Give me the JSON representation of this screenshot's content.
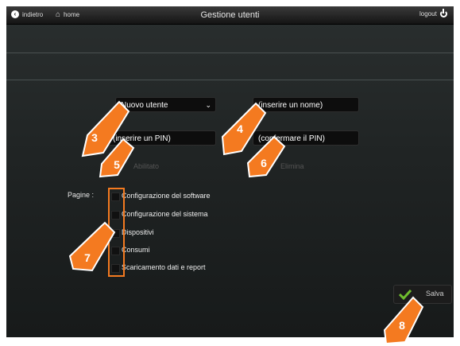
{
  "header": {
    "back_label": "indietro",
    "home_label": "home",
    "title": "Gestione utenti",
    "logout_label": "logout"
  },
  "form": {
    "user_select_value": "Nuovo utente",
    "name_placeholder": "(inserire un nome)",
    "pin_placeholder": "(inserire un PIN)",
    "pin_confirm_placeholder": "(confermare il PIN)",
    "enabled_label": "Abilitato",
    "admin_label": "Elimina"
  },
  "pages": {
    "label": "Pagine :",
    "items": [
      {
        "label": "Configurazione del software",
        "checked": false
      },
      {
        "label": "Configurazione del sistema",
        "checked": false
      },
      {
        "label": "Dispositivi",
        "checked": false
      },
      {
        "label": "Consumi",
        "checked": false
      },
      {
        "label": "Scaricamento dati e report",
        "checked": false
      }
    ]
  },
  "actions": {
    "save_label": "Salva"
  },
  "callouts": [
    "3",
    "4",
    "5",
    "6",
    "7",
    "8"
  ],
  "colors": {
    "accent": "#f47a20",
    "save_check": "#6fbe2e"
  }
}
